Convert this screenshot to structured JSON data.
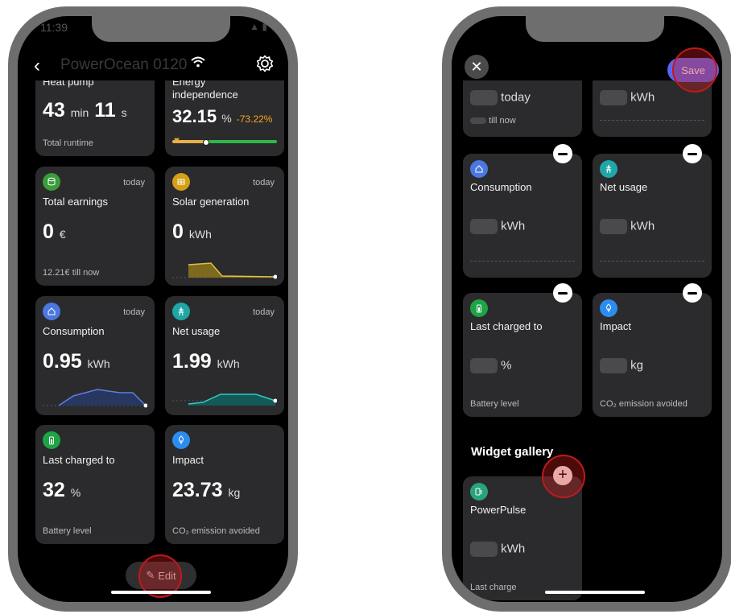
{
  "left_phone": {
    "status_time": "11:39",
    "device_name": "PowerOcean 0120",
    "cards": {
      "heat_pump": {
        "title": "Heat pump",
        "min": "43",
        "min_unit": "min",
        "sec": "11",
        "sec_unit": "s",
        "foot": "Total runtime"
      },
      "energy_independence": {
        "title_l1": "Energy",
        "title_l2": "independence",
        "value": "32.15",
        "unit": "%",
        "delta": "-73.22%",
        "level": 0.32
      },
      "total_earnings": {
        "period": "today",
        "title": "Total earnings",
        "value": "0",
        "unit": "€",
        "foot": "12.21€ till now"
      },
      "solar_generation": {
        "period": "today",
        "title": "Solar generation",
        "value": "0",
        "unit": "kWh"
      },
      "consumption": {
        "period": "today",
        "title": "Consumption",
        "value": "0.95",
        "unit": "kWh"
      },
      "net_usage": {
        "period": "today",
        "title": "Net usage",
        "value": "1.99",
        "unit": "kWh"
      },
      "last_charged": {
        "title": "Last charged to",
        "value": "32",
        "unit": "%",
        "foot": "Battery level"
      },
      "impact": {
        "title": "Impact",
        "value": "23.73",
        "unit": "kg",
        "foot": "CO₂ emission avoided"
      }
    },
    "edit_label": "Edit"
  },
  "right_phone": {
    "save_label": "Save",
    "cards": {
      "partial_left": {
        "unit": "today",
        "foot": "till now"
      },
      "partial_right": {
        "unit": "kWh"
      },
      "consumption": {
        "title": "Consumption",
        "unit": "kWh"
      },
      "net_usage": {
        "title": "Net usage",
        "unit": "kWh"
      },
      "last_charged": {
        "title": "Last charged to",
        "unit": "%",
        "foot": "Battery level"
      },
      "impact": {
        "title": "Impact",
        "unit": "kg",
        "foot": "CO₂ emission avoided"
      }
    },
    "gallery_title": "Widget gallery",
    "gallery_card": {
      "title": "PowerPulse",
      "unit": "kWh",
      "foot": "Last charge"
    }
  },
  "colors": {
    "earnings_icon": "#3c9b3c",
    "solar_icon": "#d4a017",
    "consumption_icon": "#4a78e0",
    "net_icon": "#1fa6a6",
    "battery_icon": "#1ea345",
    "impact_icon": "#2d8cf0",
    "powerpulse_icon": "#2aa37a",
    "save_button": "#5d65f0",
    "delta_orange": "#f5a623"
  }
}
